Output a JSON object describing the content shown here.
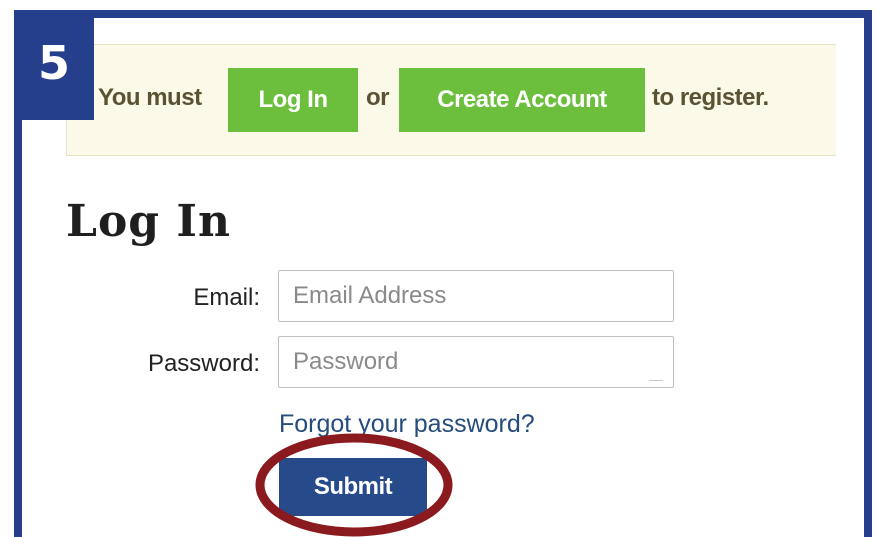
{
  "step": {
    "number": "5"
  },
  "notice": {
    "prefix": "You must",
    "login_button": "Log In",
    "connector": "or",
    "create_button": "Create Account",
    "suffix": "to register."
  },
  "form": {
    "title": "Log In",
    "email_label": "Email:",
    "email_placeholder": "Email Address",
    "password_label": "Password:",
    "password_placeholder": "Password",
    "forgot_link": "Forgot your password?",
    "submit_label": "Submit"
  },
  "colors": {
    "frame_accent": "#263f8c",
    "notice_bg": "#fbfae8",
    "green_button": "#6cbf3c",
    "submit_button": "#274a8a",
    "highlight_ring": "#8b1a1f",
    "link": "#264c7d"
  }
}
